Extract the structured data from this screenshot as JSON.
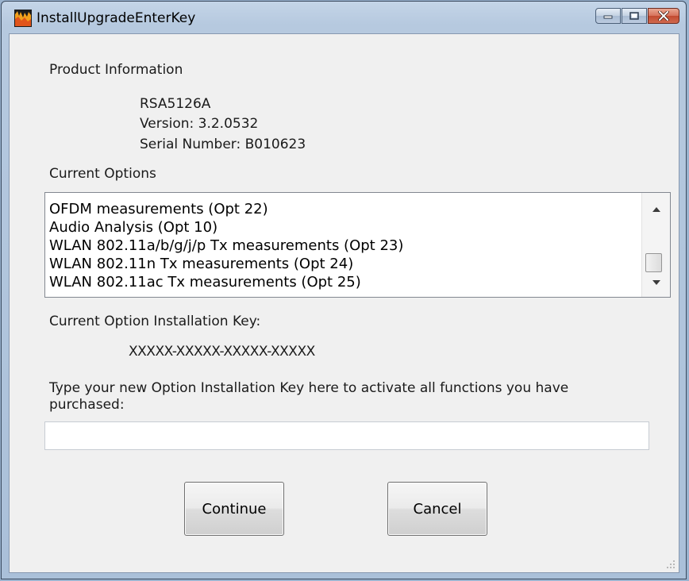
{
  "window": {
    "title": "InstallUpgradeEnterKey"
  },
  "product": {
    "section_label": "Product Information",
    "model": "RSA5126A",
    "version": "Version: 3.2.0532",
    "serial": "Serial Number: B010623"
  },
  "options": {
    "section_label": "Current Options",
    "items": [
      "OFDM measurements (Opt 22)",
      "Audio Analysis (Opt 10)",
      "WLAN 802.11a/b/g/j/p Tx measurements (Opt 23)",
      "WLAN 802.11n Tx measurements (Opt 24)",
      "WLAN 802.11ac Tx measurements (Opt 25)"
    ]
  },
  "key": {
    "current_label": "Current Option Installation Key:",
    "current_value": "XXXXX-XXXXX-XXXXX-XXXXX",
    "prompt_line1": "Type your new Option Installation Key here to activate all functions you have",
    "prompt_line2": "purchased:",
    "input_value": ""
  },
  "buttons": {
    "continue": "Continue",
    "cancel": "Cancel"
  },
  "icons": {
    "app": "tektronix-app-icon",
    "minimize": "minimize-icon",
    "maximize": "maximize-icon",
    "close": "close-icon",
    "scroll_up": "scroll-up-arrow-icon",
    "scroll_down": "scroll-down-arrow-icon",
    "resize_grip": "resize-grip-icon"
  },
  "colors": {
    "close_button": "#c24a30",
    "title_bar": "#b6c9df",
    "client_background": "#f0f0f0"
  }
}
